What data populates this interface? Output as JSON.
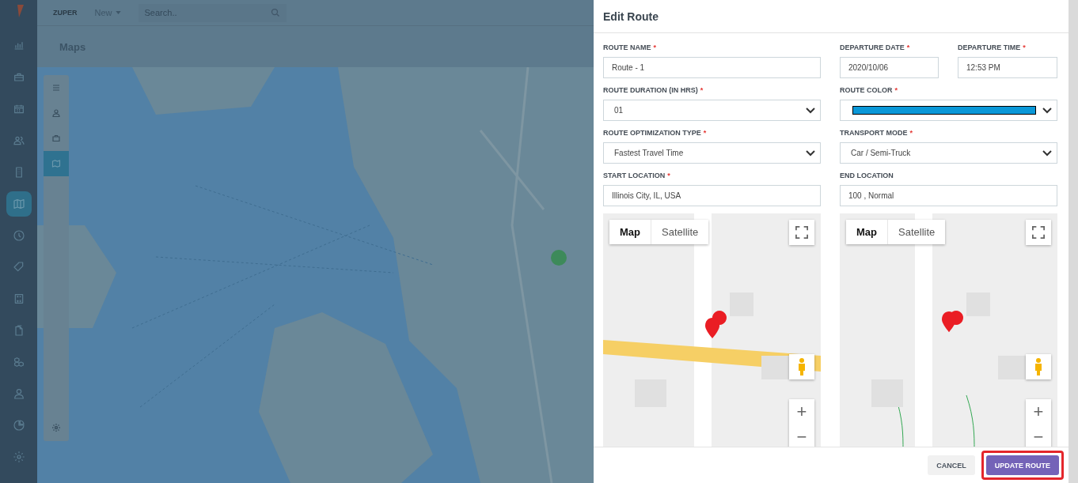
{
  "background_app": {
    "logo": "ZUPER",
    "new_menu": "New",
    "search": {
      "placeholder": "Search.."
    },
    "page_title": "Maps",
    "nav": [
      {
        "selected": false
      },
      {
        "selected": false
      },
      {
        "selected": false
      },
      {
        "selected": false
      },
      {
        "selected": false
      },
      {
        "selected": true
      },
      {
        "selected": false
      },
      {
        "selected": false
      },
      {
        "selected": false
      },
      {
        "selected": false
      },
      {
        "selected": false
      },
      {
        "selected": false
      },
      {
        "selected": false
      },
      {
        "selected": false
      }
    ],
    "map_toolbar": [
      {
        "selected": false
      },
      {
        "selected": false
      },
      {
        "selected": false
      },
      {
        "selected": true
      }
    ]
  },
  "dialog": {
    "title": "Edit Route",
    "required_mark": "*",
    "fields": [
      {
        "kind": "text",
        "label": "ROUTE NAME",
        "required": true,
        "value": "Route - 1"
      },
      {
        "kind": "text",
        "label": "DEPARTURE DATE",
        "required": true,
        "value": "2020/10/06"
      },
      {
        "kind": "text",
        "label": "DEPARTURE TIME",
        "required": true,
        "value": "12:53 PM"
      },
      {
        "kind": "select",
        "label": "ROUTE DURATION (IN HRS)",
        "required": true,
        "value": "01"
      },
      {
        "kind": "color",
        "label": "ROUTE COLOR",
        "required": true,
        "color": "#0a98d8"
      },
      {
        "kind": "select",
        "label": "ROUTE OPTIMIZATION TYPE",
        "required": true,
        "value": "Fastest Travel Time"
      },
      {
        "kind": "select",
        "label": "TRANSPORT MODE",
        "required": true,
        "value": "Car / Semi-Truck"
      },
      {
        "kind": "text",
        "label": "START LOCATION",
        "required": true,
        "value": "Illinois City, IL, USA"
      },
      {
        "kind": "text",
        "label": "END LOCATION",
        "required": false,
        "value": "100 , Normal"
      }
    ],
    "maps": [
      {
        "type_buttons": [
          {
            "label": "Map",
            "selected": true
          },
          {
            "label": "Satellite",
            "selected": false
          }
        ],
        "zoom_in": "+",
        "zoom_out": "−"
      },
      {
        "type_buttons": [
          {
            "label": "Map",
            "selected": true
          },
          {
            "label": "Satellite",
            "selected": false
          }
        ],
        "zoom_in": "+",
        "zoom_out": "−"
      }
    ],
    "buttons": [
      {
        "kind": "secondary",
        "label": "CANCEL",
        "highlighted": false
      },
      {
        "kind": "primary",
        "label": "UPDATE ROUTE",
        "highlighted": true
      }
    ]
  }
}
